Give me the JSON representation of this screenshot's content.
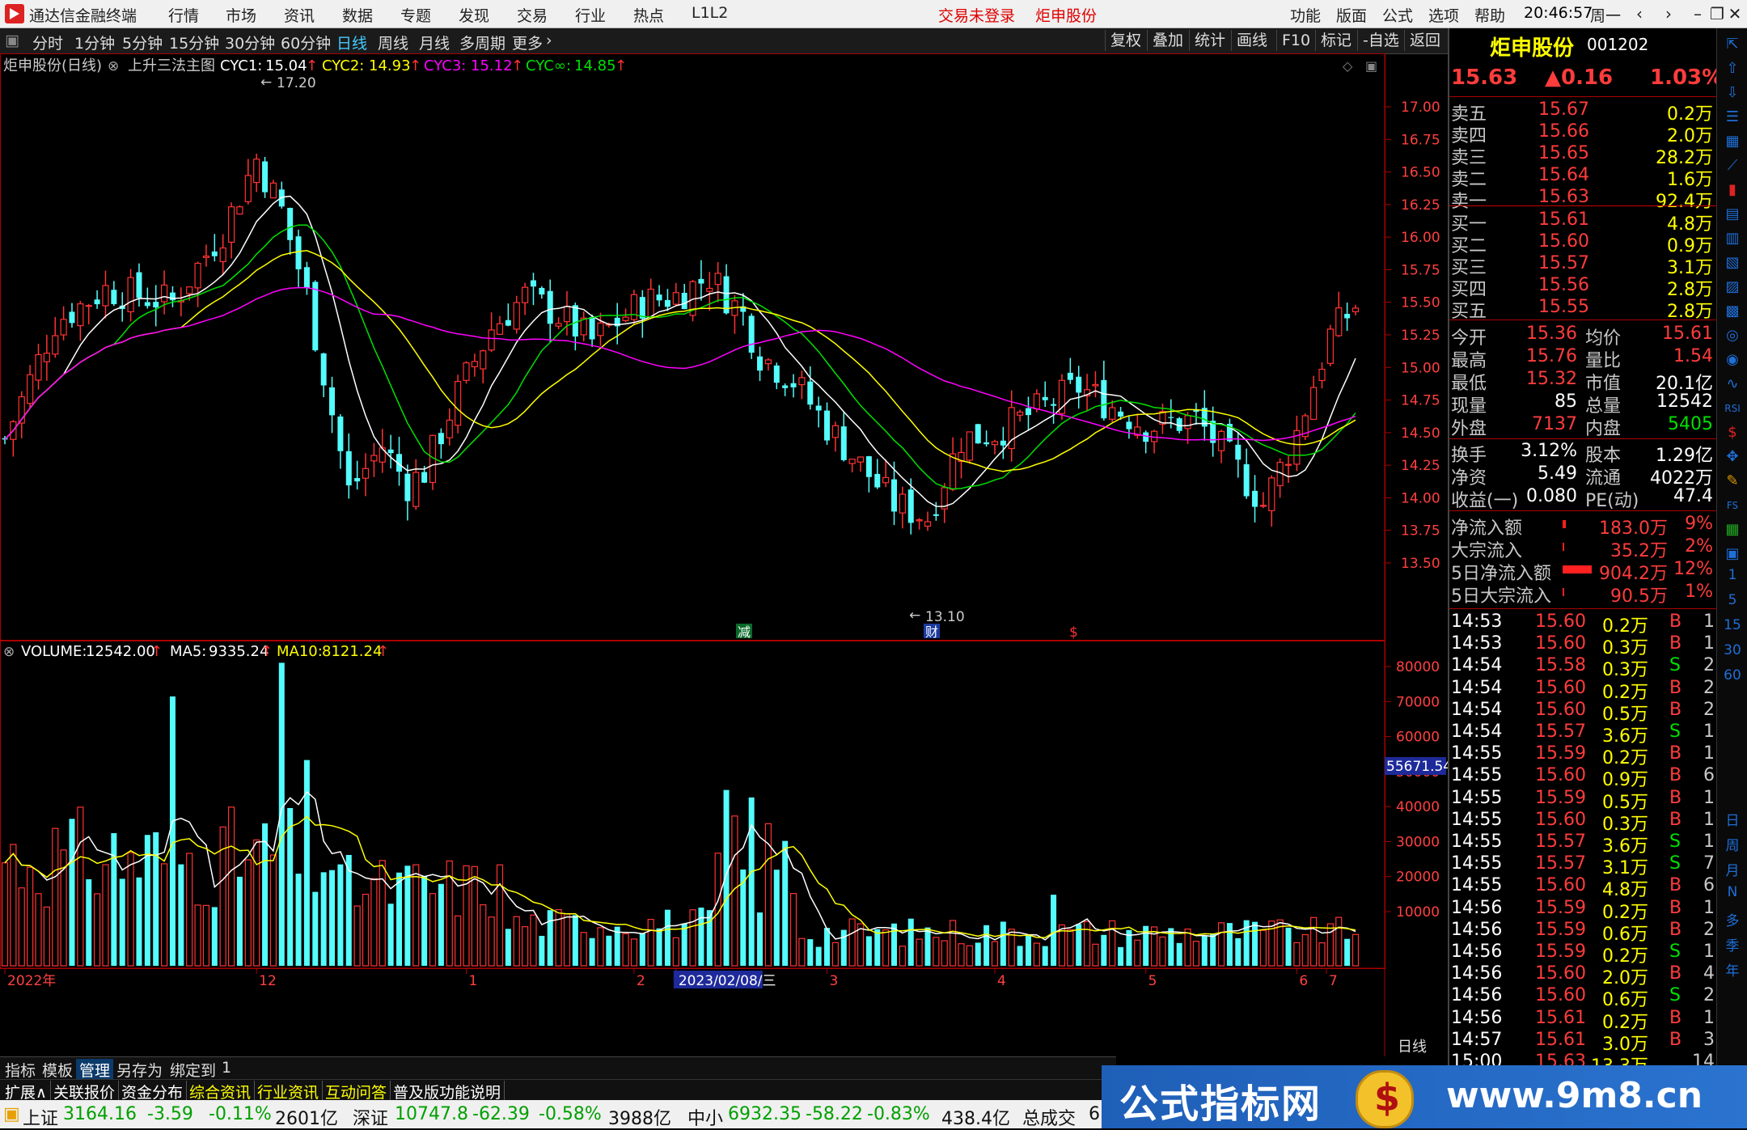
{
  "titlebar": {
    "app_name": "通达信金融终端",
    "menus": [
      "行情",
      "市场",
      "资讯",
      "数据",
      "专题",
      "发现",
      "交易",
      "行业",
      "热点",
      "L1L2"
    ],
    "login_status": "交易未登录",
    "stock_title": "炬申股份",
    "right_menus": [
      "功能",
      "版面",
      "公式",
      "选项",
      "帮助"
    ],
    "time": "20:46:57",
    "weekday": "周一",
    "icons": [
      "back-icon",
      "forward-icon",
      "minimize-icon",
      "restore-icon",
      "close-icon"
    ]
  },
  "periodbar": {
    "periods": [
      "分时",
      "1分钟",
      "5分钟",
      "15分钟",
      "30分钟",
      "60分钟",
      "日线",
      "周线",
      "月线",
      "多周期",
      "更多"
    ],
    "active": "日线",
    "tools": [
      "复权",
      "叠加",
      "统计",
      "画线",
      "F10",
      "标记",
      "-自选",
      "返回"
    ]
  },
  "chart": {
    "header": {
      "name": "炬申股份(日线)",
      "formula": "上升三法主图",
      "cyc1_label": "CYC1:",
      "cyc1": "15.04",
      "cyc2_label": "CYC2:",
      "cyc2": "14.93",
      "cyc3_label": "CYC3:",
      "cyc3": "15.12",
      "cycinf_label": "CYC∞:",
      "cycinf": "14.85"
    },
    "high_mark": "17.20",
    "low_mark": "13.10",
    "event_marks": [
      "减",
      "财",
      "$"
    ],
    "price_axis": [
      "17.00",
      "16.75",
      "16.50",
      "16.25",
      "16.00",
      "15.75",
      "15.50",
      "15.25",
      "15.00",
      "14.75",
      "14.50",
      "14.25",
      "14.00",
      "13.75",
      "13.50"
    ],
    "volume_header": {
      "label": "VOLUME:",
      "volume": "12542.00",
      "ma5_label": "MA5:",
      "ma5": "9335.24",
      "ma10_label": "MA10:",
      "ma10": "8121.24"
    },
    "volume_axis": [
      "80000",
      "70000",
      "60000",
      "50000",
      "40000",
      "30000",
      "20000",
      "10000"
    ],
    "volume_cursor": "55671.54",
    "time_axis": [
      "2022年",
      "12",
      "1",
      "2",
      "2023/02/08/三",
      "3",
      "4",
      "5",
      "6",
      "7"
    ],
    "period_label": "日线",
    "colors": {
      "up": "#ff3232",
      "down": "#54fcfc",
      "cyc1": "#ffffff",
      "cyc2": "#ffff00",
      "cyc3": "#ff00ff",
      "cycinf": "#00e000",
      "ma5": "#ffffff",
      "ma10": "#ffff00"
    }
  },
  "quote": {
    "name": "炬申股份",
    "code": "001202",
    "price": "15.63",
    "change": "▲0.16",
    "pct": "1.03%",
    "asks": [
      {
        "label": "卖五",
        "price": "15.67",
        "vol": "0.2万"
      },
      {
        "label": "卖四",
        "price": "15.66",
        "vol": "2.0万"
      },
      {
        "label": "卖三",
        "price": "15.65",
        "vol": "28.2万"
      },
      {
        "label": "卖二",
        "price": "15.64",
        "vol": "1.6万"
      },
      {
        "label": "卖一",
        "price": "15.63",
        "vol": "92.4万"
      }
    ],
    "bids": [
      {
        "label": "买一",
        "price": "15.61",
        "vol": "4.8万"
      },
      {
        "label": "买二",
        "price": "15.60",
        "vol": "0.9万"
      },
      {
        "label": "买三",
        "price": "15.57",
        "vol": "3.1万"
      },
      {
        "label": "买四",
        "price": "15.56",
        "vol": "2.8万"
      },
      {
        "label": "买五",
        "price": "15.55",
        "vol": "2.8万"
      }
    ],
    "stats1": [
      {
        "l1": "今开",
        "v1": "15.36",
        "l2": "均价",
        "v2": "15.61"
      },
      {
        "l1": "最高",
        "v1": "15.76",
        "l2": "量比",
        "v2": "1.54"
      },
      {
        "l1": "最低",
        "v1": "15.32",
        "l2": "市值",
        "v2": "20.1亿"
      },
      {
        "l1": "现量",
        "v1": "85",
        "l2": "总量",
        "v2": "12542"
      },
      {
        "l1": "外盘",
        "v1": "7137",
        "l2": "内盘",
        "v2": "5405"
      }
    ],
    "stats2": [
      {
        "l1": "换手",
        "v1": "3.12%",
        "l2": "股本",
        "v2": "1.29亿"
      },
      {
        "l1": "净资",
        "v1": "5.49",
        "l2": "流通",
        "v2": "4022万"
      },
      {
        "l1": "收益(一)",
        "v1": "0.080",
        "l2": "PE(动)",
        "v2": "47.4"
      }
    ],
    "flows": [
      {
        "label": "净流入额",
        "value": "183.0万",
        "pct": "9%"
      },
      {
        "label": "大宗流入",
        "value": "35.2万",
        "pct": "2%"
      },
      {
        "label": "5日净流入额",
        "value": "904.2万",
        "pct": "12%"
      },
      {
        "label": "5日大宗流入",
        "value": "90.5万",
        "pct": "1%"
      }
    ],
    "ticks": [
      {
        "t": "14:53",
        "p": "15.60",
        "v": "0.2万",
        "bs": "B",
        "n": "1"
      },
      {
        "t": "14:53",
        "p": "15.60",
        "v": "0.3万",
        "bs": "B",
        "n": "1"
      },
      {
        "t": "14:54",
        "p": "15.58",
        "v": "0.3万",
        "bs": "S",
        "n": "2"
      },
      {
        "t": "14:54",
        "p": "15.60",
        "v": "0.2万",
        "bs": "B",
        "n": "2"
      },
      {
        "t": "14:54",
        "p": "15.60",
        "v": "0.5万",
        "bs": "B",
        "n": "2"
      },
      {
        "t": "14:54",
        "p": "15.57",
        "v": "3.6万",
        "bs": "S",
        "n": "1"
      },
      {
        "t": "14:55",
        "p": "15.59",
        "v": "0.2万",
        "bs": "B",
        "n": "1"
      },
      {
        "t": "14:55",
        "p": "15.60",
        "v": "0.9万",
        "bs": "B",
        "n": "6"
      },
      {
        "t": "14:55",
        "p": "15.59",
        "v": "0.5万",
        "bs": "B",
        "n": "1"
      },
      {
        "t": "14:55",
        "p": "15.60",
        "v": "0.3万",
        "bs": "B",
        "n": "1"
      },
      {
        "t": "14:55",
        "p": "15.57",
        "v": "3.6万",
        "bs": "S",
        "n": "1"
      },
      {
        "t": "14:55",
        "p": "15.57",
        "v": "3.1万",
        "bs": "S",
        "n": "7"
      },
      {
        "t": "14:55",
        "p": "15.60",
        "v": "4.8万",
        "bs": "B",
        "n": "6"
      },
      {
        "t": "14:56",
        "p": "15.59",
        "v": "0.2万",
        "bs": "B",
        "n": "1"
      },
      {
        "t": "14:56",
        "p": "15.59",
        "v": "0.6万",
        "bs": "B",
        "n": "2"
      },
      {
        "t": "14:56",
        "p": "15.59",
        "v": "0.2万",
        "bs": "S",
        "n": "1"
      },
      {
        "t": "14:56",
        "p": "15.60",
        "v": "2.0万",
        "bs": "B",
        "n": "4"
      },
      {
        "t": "14:56",
        "p": "15.60",
        "v": "0.6万",
        "bs": "S",
        "n": "2"
      },
      {
        "t": "14:56",
        "p": "15.61",
        "v": "0.2万",
        "bs": "B",
        "n": "1"
      },
      {
        "t": "14:57",
        "p": "15.61",
        "v": "3.0万",
        "bs": "B",
        "n": "3"
      },
      {
        "t": "15:00",
        "p": "15.63",
        "v": "13.3万",
        "bs": "",
        "n": "14"
      }
    ]
  },
  "side_labels": [
    "日",
    "周",
    "月",
    "N",
    "多",
    "季",
    "年",
    "1",
    "5",
    "15",
    "30",
    "60"
  ],
  "bottom": {
    "tabs1": [
      "指标",
      "模板",
      "管理",
      "另存为",
      "绑定到",
      "1"
    ],
    "tabs1_selected": "管理",
    "tabs2": [
      "扩展∧",
      "关联报价",
      "资金分布",
      "综合资讯",
      "行业资讯",
      "互动问答",
      "普及版功能说明"
    ],
    "indices": [
      {
        "name": "上证",
        "value": "3164.16",
        "chg": "-3.59",
        "pct": "-0.11%",
        "amt": "2601亿"
      },
      {
        "name": "深证",
        "value": "10747.8",
        "chg": "-62.39",
        "pct": "-0.58%",
        "amt": "3988亿"
      },
      {
        "name": "中小",
        "value": "6932.35",
        "chg": "-58.22",
        "pct": "-0.83%",
        "amt": "438.4亿"
      }
    ],
    "total_label": "总成交",
    "total_partial": "6"
  },
  "banner": {
    "title": "公式指标网",
    "url": "www.9m8.cn"
  }
}
